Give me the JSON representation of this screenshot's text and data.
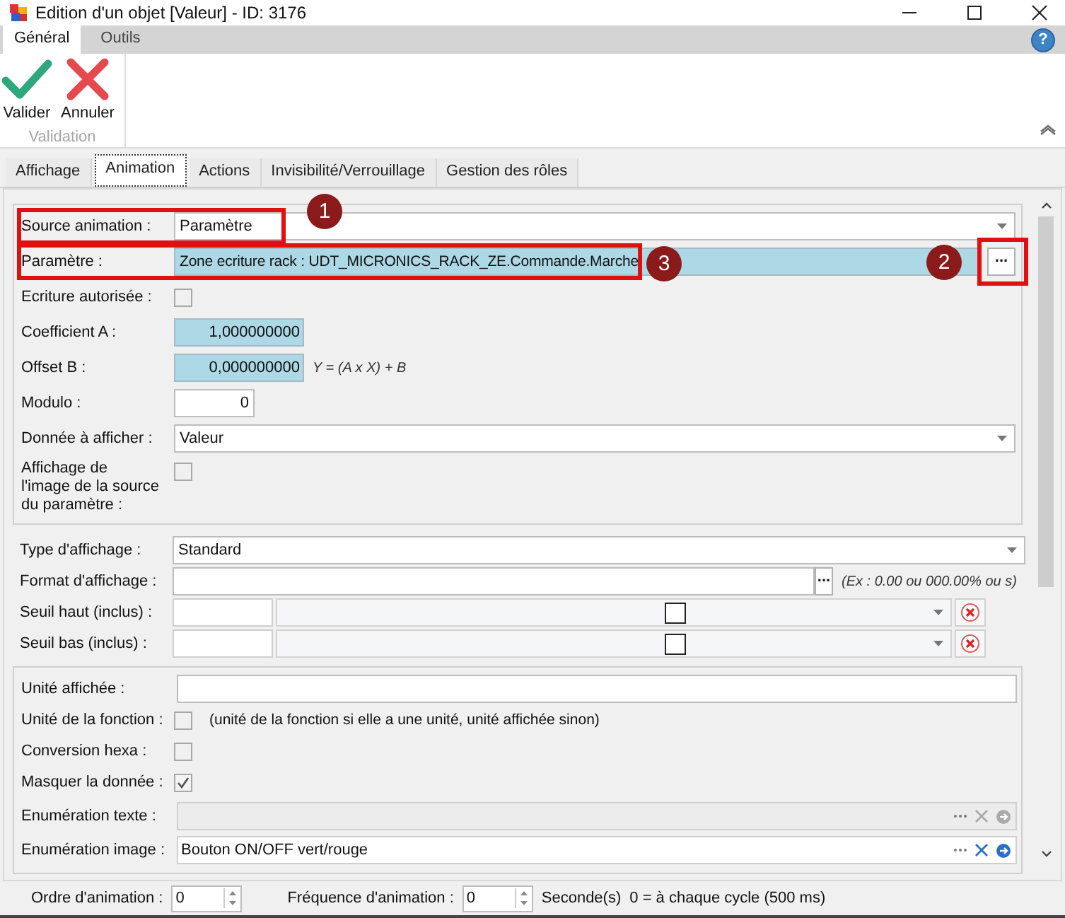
{
  "window": {
    "title": "Edition d'un objet [Valeur] - ID: 3176"
  },
  "ribbon": {
    "tabs": [
      {
        "label": "Général",
        "selected": true
      },
      {
        "label": "Outils",
        "selected": false
      }
    ],
    "help": "?",
    "buttons": [
      {
        "label": "Valider",
        "kind": "confirm"
      },
      {
        "label": "Annuler",
        "kind": "cancel"
      }
    ],
    "group_label": "Validation"
  },
  "tabs": [
    {
      "label": "Affichage",
      "selected": false
    },
    {
      "label": "Animation",
      "selected": true
    },
    {
      "label": "Actions",
      "selected": false
    },
    {
      "label": "Invisibilité/Verrouillage",
      "selected": false
    },
    {
      "label": "Gestion des rôles",
      "selected": false
    }
  ],
  "sections": [
    {
      "boxed": true,
      "rows": [
        {
          "kind": "combo",
          "label": "Source animation :",
          "value": "Paramètre",
          "marker": "1"
        },
        {
          "kind": "param",
          "label": "Paramètre :",
          "value": "Zone ecriture rack : UDT_MICRONICS_RACK_ZE.Commande.Marche",
          "button": "...",
          "marker": "3",
          "button_marker": "2"
        },
        {
          "kind": "checkbox",
          "label": "Ecriture autorisée :",
          "checked": false
        },
        {
          "kind": "readonly",
          "label": "Coefficient A :",
          "value": "1,000000000"
        },
        {
          "kind": "readonly",
          "label": "Offset B :",
          "value": "0,000000000",
          "note": "Y = (A x X) + B"
        },
        {
          "kind": "number",
          "label": "Modulo :",
          "value": "0"
        },
        {
          "kind": "combo",
          "label": "Donnée à afficher :",
          "value": "Valeur"
        },
        {
          "kind": "checkbox",
          "label": "Affichage de l'image de la source du paramètre :",
          "checked": false
        }
      ]
    },
    {
      "boxed": false,
      "rows": [
        {
          "kind": "combo",
          "label": "Type d'affichage :",
          "value": "Standard"
        },
        {
          "kind": "format",
          "label": "Format d'affichage :",
          "button": "...",
          "note": "(Ex : 0.00 ou 000.00% ou s)"
        },
        {
          "kind": "threshold",
          "label": "Seuil haut (inclus) :"
        },
        {
          "kind": "threshold",
          "label": "Seuil bas (inclus) :"
        }
      ]
    },
    {
      "boxed": true,
      "rows": [
        {
          "kind": "text",
          "label": "Unité affichée :"
        },
        {
          "kind": "checkbox",
          "label": "Unité de la fonction :",
          "checked": false,
          "note": "(unité de la fonction si elle a une unité, unité affichée sinon)"
        },
        {
          "kind": "checkbox",
          "label": "Conversion hexa :",
          "checked": false
        },
        {
          "kind": "checkbox",
          "label": "Masquer la donnée :",
          "checked": true
        },
        {
          "kind": "enum",
          "label": "Enumération texte :",
          "disabled": true
        },
        {
          "kind": "enum",
          "label": "Enumération image :",
          "value": "Bouton ON/OFF vert/rouge",
          "disabled": false
        }
      ]
    }
  ],
  "footer": {
    "order_label": "Ordre d'animation :",
    "order_value": "0",
    "freq_label": "Fréquence d'animation :",
    "freq_value": "0",
    "unit": "Seconde(s)",
    "hint": "0 = à chaque cycle (500 ms)"
  }
}
